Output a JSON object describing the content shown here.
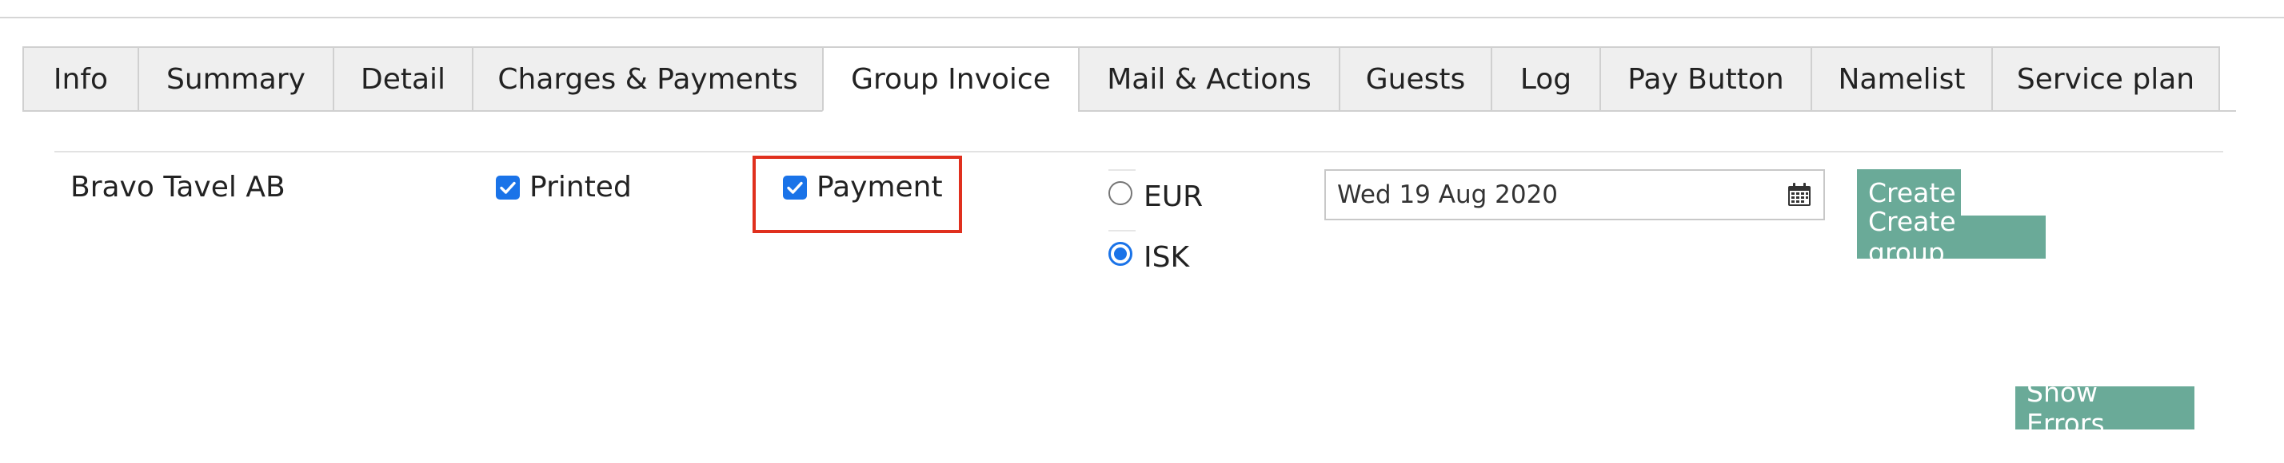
{
  "tabs": [
    {
      "label": "Info"
    },
    {
      "label": "Summary"
    },
    {
      "label": "Detail"
    },
    {
      "label": "Charges & Payments"
    },
    {
      "label": "Group Invoice",
      "active": true
    },
    {
      "label": "Mail & Actions"
    },
    {
      "label": "Guests"
    },
    {
      "label": "Log"
    },
    {
      "label": "Pay Button"
    },
    {
      "label": "Namelist"
    },
    {
      "label": "Service plan"
    }
  ],
  "invoice": {
    "company": "Bravo Tavel AB",
    "printed_label": "Printed",
    "printed_checked": true,
    "payment_label": "Payment",
    "payment_checked": true,
    "currency_options": [
      "EUR",
      "ISK"
    ],
    "currency_selected": "ISK",
    "date_value": "Wed 19 Aug 2020",
    "create_label": "Create",
    "create_group_label": "Create group",
    "show_errors_label": "Show Errors"
  },
  "icons": {
    "checkbox": "check-icon",
    "date": "calendar-icon"
  },
  "colors": {
    "button_bg": "#6aaa98",
    "checkbox_blue": "#1a73e8",
    "highlight_red": "#e0301e",
    "tab_bg": "#efefef"
  }
}
